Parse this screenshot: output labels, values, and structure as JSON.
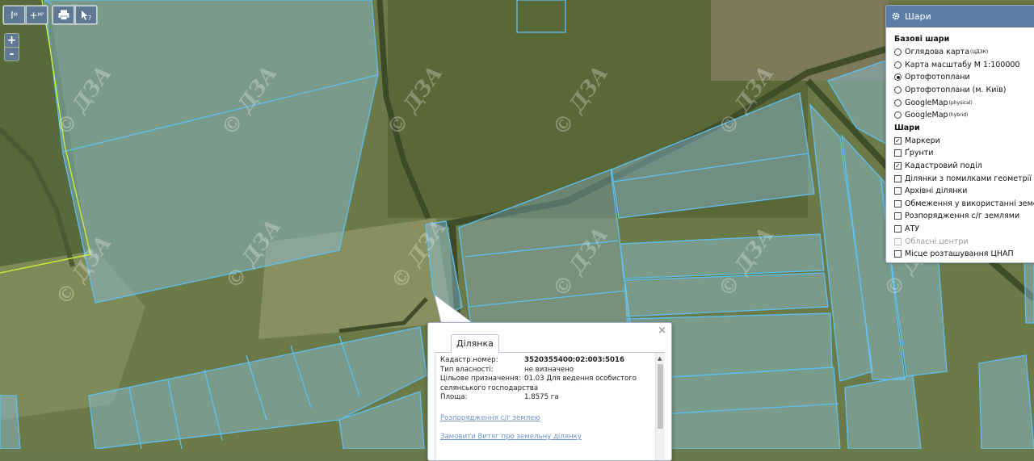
{
  "map": {
    "watermark": "© ДЗА",
    "colors": {
      "field_dark": "#5e6a3a",
      "field_mid": "#77804e",
      "parcel_fill": "#8ec5e6",
      "parcel_stroke": "#5cc0f2",
      "admin_boundary": "#c6e83a",
      "tree_line": "#3f4d29"
    }
  },
  "toolbar": {
    "measure_label": "I",
    "measure_sub": "M",
    "measure_area_label": "+",
    "measure_area_sub": "M²",
    "print_icon": "printer-icon",
    "identify_icon": "cursor-question-icon"
  },
  "zoom": {
    "in_label": "+",
    "out_label": "-"
  },
  "layers": {
    "title": "Шари",
    "title_icon": "gear-icon",
    "base_title": "Базові шари",
    "base": [
      {
        "label": "Оглядова карта",
        "sup": "(ЦДЗК)",
        "selected": false
      },
      {
        "label": "Карта масштабу М 1:100000",
        "sup": "",
        "selected": false
      },
      {
        "label": "Ортофотоплани",
        "sup": "",
        "selected": true
      },
      {
        "label": "Ортофотоплани (м. Київ)",
        "sup": "",
        "selected": false
      },
      {
        "label": "GoogleMap",
        "sup": "(physical)",
        "selected": false
      },
      {
        "label": "GoogleMap",
        "sup": "(hybrid)",
        "selected": false
      }
    ],
    "overlay_title": "Шари",
    "overlays": [
      {
        "label": "Маркери",
        "checked": true,
        "disabled": false
      },
      {
        "label": "Ґрунти",
        "checked": false,
        "disabled": false
      },
      {
        "label": "Кадастровий поділ",
        "checked": true,
        "disabled": false
      },
      {
        "label": "Ділянки з помилками геометрії",
        "checked": false,
        "disabled": false
      },
      {
        "label": "Архівні ділянки",
        "checked": false,
        "disabled": false
      },
      {
        "label": "Обмеження у використанні земель",
        "checked": false,
        "disabled": false
      },
      {
        "label": "Розпорядження с/г землями",
        "checked": false,
        "disabled": false
      },
      {
        "label": "АТУ",
        "checked": false,
        "disabled": false
      },
      {
        "label": "Обласні центри",
        "checked": false,
        "disabled": true
      },
      {
        "label": "Місце розташування ЦНАП",
        "checked": false,
        "disabled": false
      }
    ]
  },
  "popup": {
    "tab": "Ділянка",
    "close": "×",
    "fields": [
      {
        "label": "Кадастр.номер:",
        "value": "3520355400:02:003:5016"
      },
      {
        "label": "Тип власності:",
        "value": "не визначено"
      },
      {
        "label": "Цільове призначення:",
        "value": "01.03 Для ведення особистого",
        "cont": "селянського господарства"
      },
      {
        "label": "Площа:",
        "value": "1.8575 га"
      }
    ],
    "links": [
      "Розпорядження с/г землею",
      "Замовити Витяг про земельну ділянку"
    ]
  }
}
